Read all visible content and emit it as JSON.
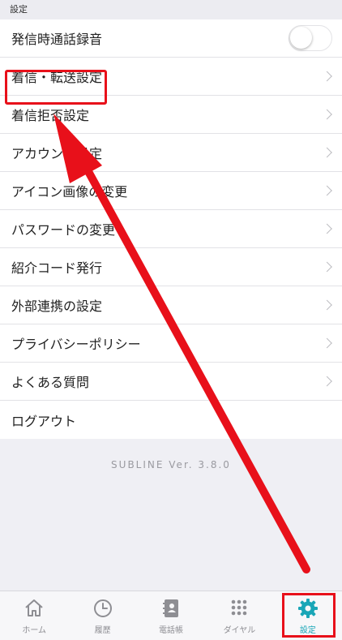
{
  "section": {
    "title": "設定"
  },
  "settings": {
    "items": [
      {
        "label": "発信時通話録音",
        "control": "toggle",
        "toggle_on": false
      },
      {
        "label": "着信・転送設定",
        "control": "chevron"
      },
      {
        "label": "着信拒否設定",
        "control": "chevron"
      },
      {
        "label": "アカウント設定",
        "control": "chevron"
      },
      {
        "label": "アイコン画像の変更",
        "control": "chevron"
      },
      {
        "label": "パスワードの変更",
        "control": "chevron"
      },
      {
        "label": "紹介コード発行",
        "control": "chevron"
      },
      {
        "label": "外部連携の設定",
        "control": "chevron"
      },
      {
        "label": "プライバシーポリシー",
        "control": "chevron"
      },
      {
        "label": "よくある質問",
        "control": "chevron"
      },
      {
        "label": "ログアウト",
        "control": "none"
      }
    ]
  },
  "footer": {
    "version": "SUBLINE Ver. 3.8.0"
  },
  "tabbar": {
    "tabs": [
      {
        "label": "ホーム",
        "icon": "home-icon"
      },
      {
        "label": "履歴",
        "icon": "clock-icon"
      },
      {
        "label": "電話帳",
        "icon": "contacts-book-icon"
      },
      {
        "label": "ダイヤル",
        "icon": "dialpad-icon"
      },
      {
        "label": "設定",
        "icon": "gear-icon",
        "active": true
      }
    ]
  },
  "colors": {
    "accent": "#1aa6b7",
    "annotation": "#e8101a",
    "inactive": "#8e8e93"
  }
}
